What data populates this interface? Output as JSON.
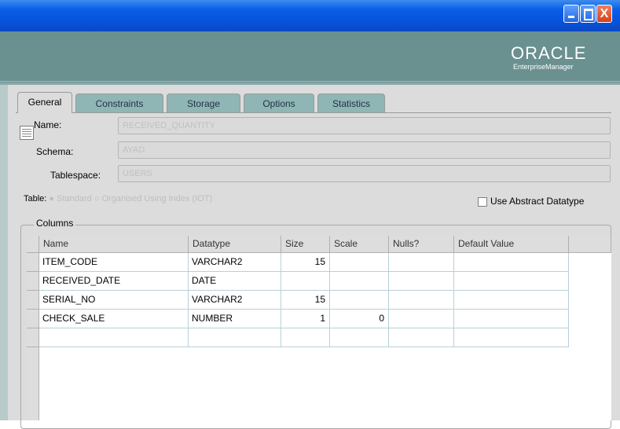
{
  "window": {
    "close_glyph": "X",
    "brand": "ORACLE",
    "brand_sub": "EnterpriseManager"
  },
  "tabs": [
    {
      "label": "General",
      "active": true
    },
    {
      "label": "Constraints",
      "active": false
    },
    {
      "label": "Storage",
      "active": false
    },
    {
      "label": "Options",
      "active": false
    },
    {
      "label": "Statistics",
      "active": false
    }
  ],
  "form": {
    "name_label": "Name:",
    "name_value": "RECEIVED_QUANTITY",
    "schema_label": "Schema:",
    "schema_value": "AYAD",
    "tablespace_label": "Tablespace:",
    "tablespace_value": "USERS",
    "table_label": "Table:",
    "radio_standard": "Standard",
    "radio_organised": "Organised Using Index (IOT)",
    "abstract_label": "Use Abstract Datatype",
    "abstract_checked": false
  },
  "columns": {
    "group_label": "Columns",
    "headers": [
      "Name",
      "Datatype",
      "Size",
      "Scale",
      "Nulls?",
      "Default Value"
    ],
    "rows": [
      {
        "name": "ITEM_CODE",
        "datatype": "VARCHAR2",
        "size": "15",
        "scale": "",
        "nulls": "",
        "default": ""
      },
      {
        "name": "RECEIVED_DATE",
        "datatype": "DATE",
        "size": "",
        "scale": "",
        "nulls": "",
        "default": ""
      },
      {
        "name": "SERIAL_NO",
        "datatype": "VARCHAR2",
        "size": "15",
        "scale": "",
        "nulls": "",
        "default": ""
      },
      {
        "name": "CHECK_SALE",
        "datatype": "NUMBER",
        "size": "1",
        "scale": "0",
        "nulls": "",
        "default": ""
      },
      {
        "name": "",
        "datatype": "",
        "size": "",
        "scale": "",
        "nulls": "",
        "default": ""
      }
    ]
  },
  "colors": {
    "titlebar": "#0a5ee8",
    "header_band": "#6a9090",
    "tab_inactive": "#8fb5b5",
    "panel": "#dcdcdc"
  }
}
